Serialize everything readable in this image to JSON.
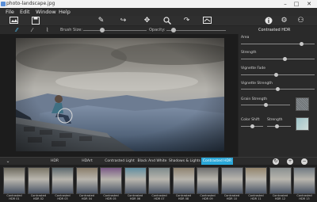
{
  "window": {
    "title": "photo-landscape.jpg"
  },
  "menu": [
    "File",
    "Edit",
    "Window",
    "Help"
  ],
  "toolbar": {
    "icons": [
      "open-icon",
      "save-icon",
      "brush-icon",
      "move-icon",
      "zoom-icon",
      "redo-icon",
      "compare-icon",
      "info-icon",
      "settings-icon",
      "share-icon"
    ]
  },
  "brushbar": {
    "brush_size_label": "Brush Size:",
    "opacity_label": "Opacity:",
    "brush_size_value": 0.3,
    "opacity_value": 0.12
  },
  "panel": {
    "title": "Contrasted HDR",
    "sliders": [
      {
        "label": "Area",
        "value": 0.82
      },
      {
        "label": "Strength",
        "value": 0.6
      },
      {
        "label": "Vignette Fade",
        "value": 0.48
      },
      {
        "label": "Vignette Strength",
        "value": 0.5
      },
      {
        "label": "Grain Strength",
        "value": 0.5
      },
      {
        "label": "Color Shift",
        "value": 0.5
      },
      {
        "label": "Strength",
        "value": 0.4
      }
    ]
  },
  "tabs": [
    "HDR",
    "HDArt",
    "Contrasted Light",
    "Black And White",
    "Shadows & Lights",
    "Contrasted HDR"
  ],
  "active_tab": "Contrasted HDR",
  "thumbnails": [
    {
      "label": "Contrasted HDR 01"
    },
    {
      "label": "Contrasted HDR 02"
    },
    {
      "label": "Contrasted HDR 03"
    },
    {
      "label": "Contrasted HDR 04"
    },
    {
      "label": "Contrasted HDR 05"
    },
    {
      "label": "Contrasted HDR 06"
    },
    {
      "label": "Contrasted HDR 07"
    },
    {
      "label": "Contrasted HDR 08"
    },
    {
      "label": "Contrasted HDR 09"
    },
    {
      "label": "Contrasted HDR 10"
    },
    {
      "label": "Contrasted HDR 11"
    },
    {
      "label": "Contrasted HDR 12"
    },
    {
      "label": "Contrasted HDR 13"
    }
  ],
  "colors": {
    "accent": "#2aa7d8"
  }
}
